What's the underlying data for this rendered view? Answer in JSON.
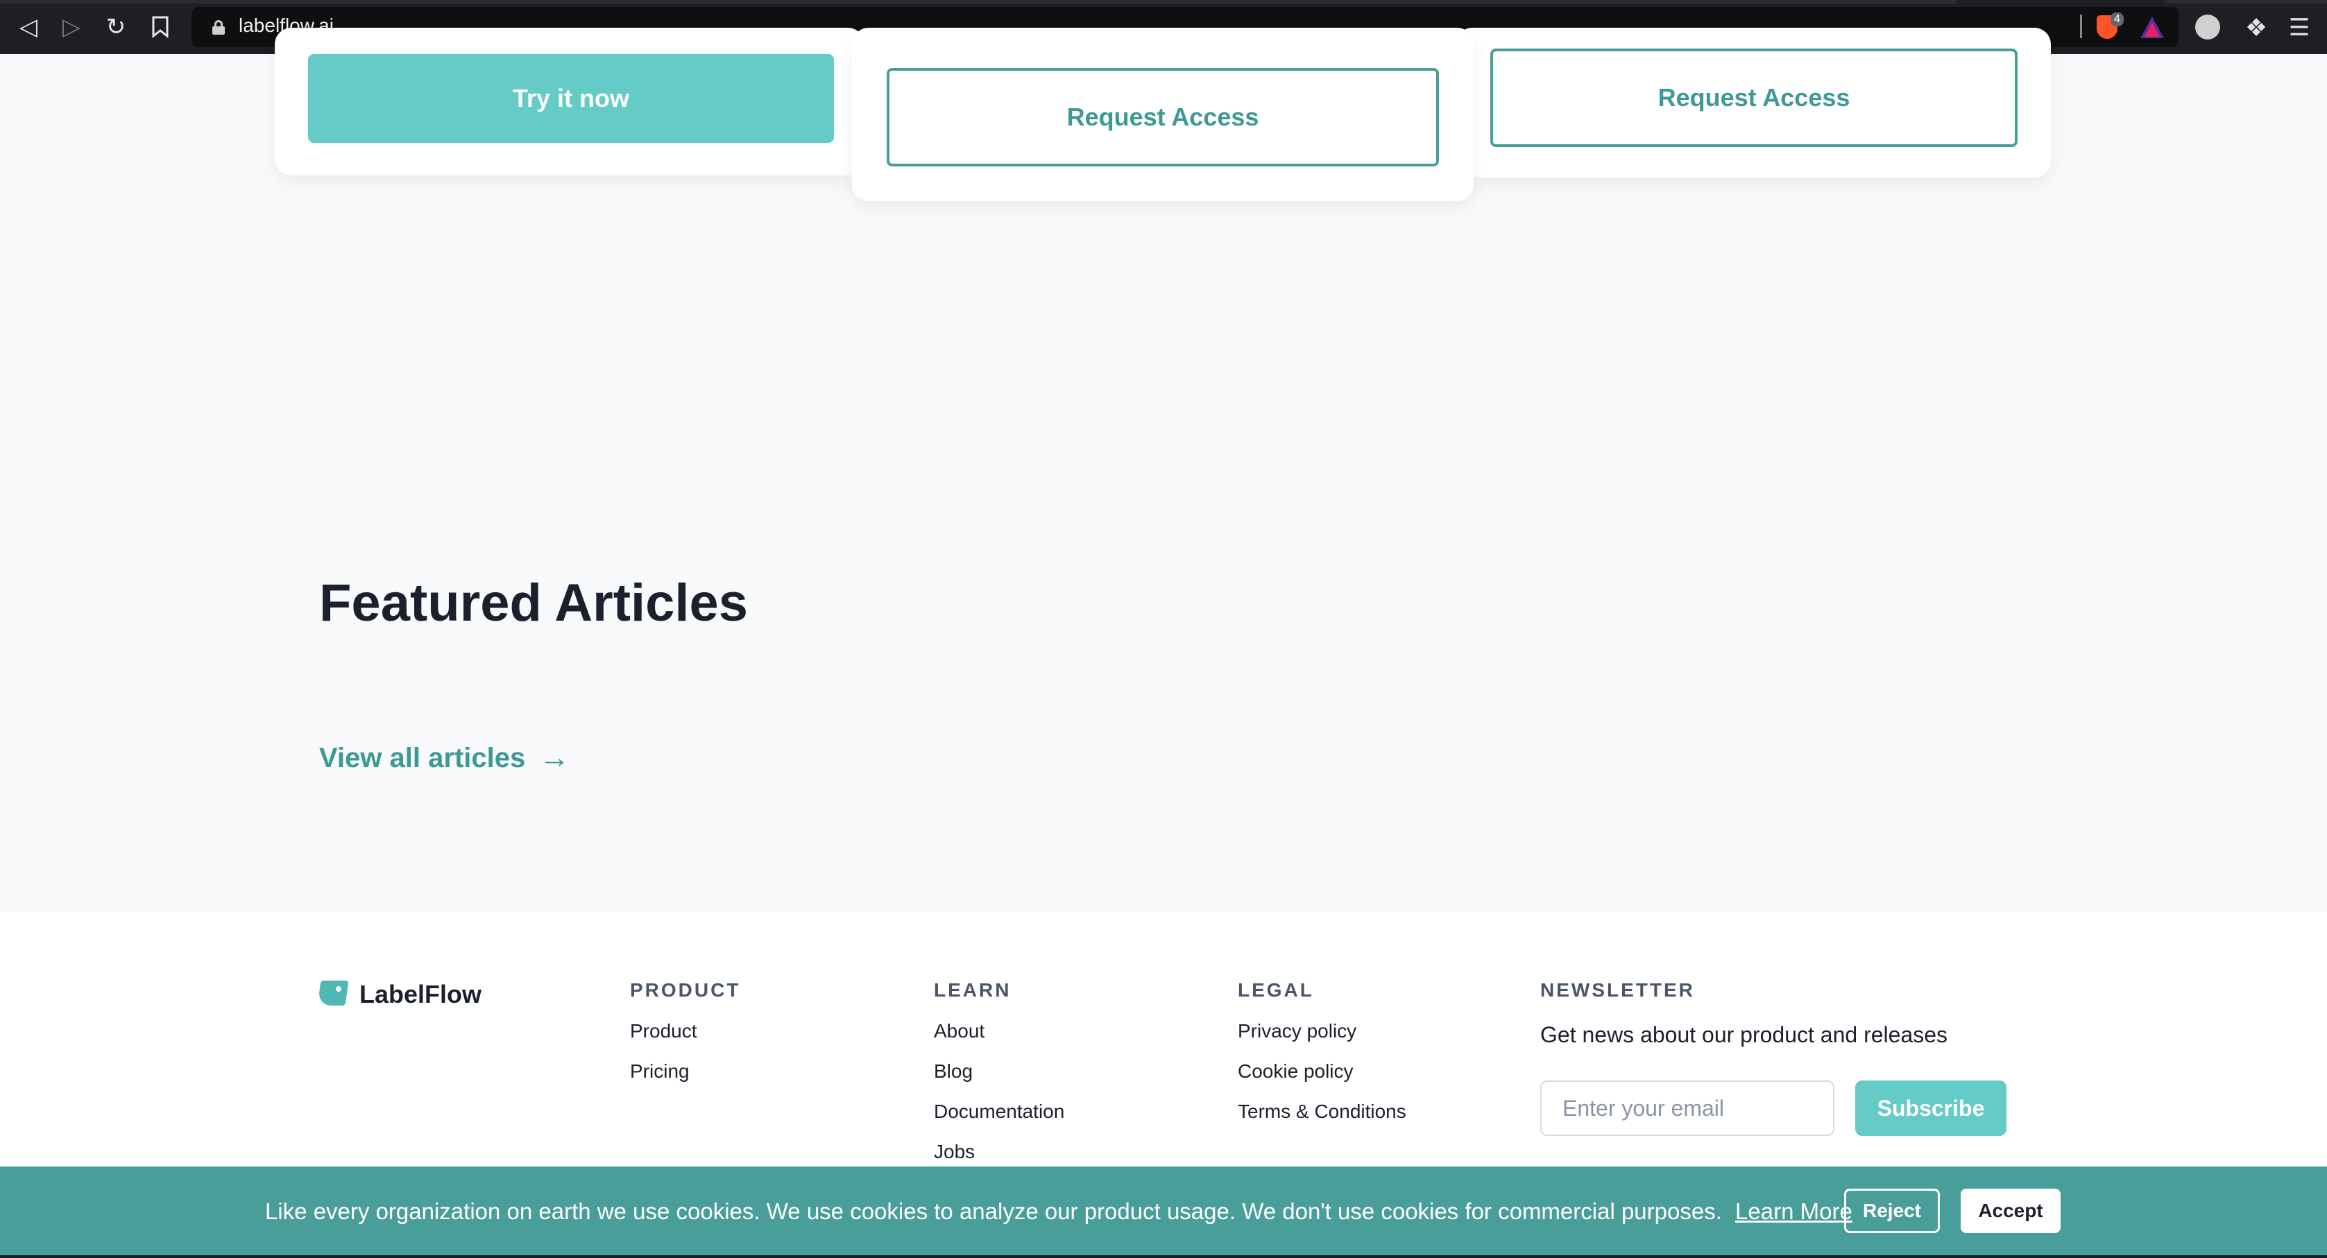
{
  "browser": {
    "url": "labelflow.ai",
    "extension_badge": "4",
    "icons": [
      "back-icon",
      "forward-icon",
      "reload-icon",
      "bookmark-icon",
      "lock-icon",
      "brave-shield-icon",
      "triangle-extension-icon",
      "profile-icon",
      "puzzle-icon",
      "menu-icon"
    ]
  },
  "pricing": {
    "card_1_button": "Try it now",
    "card_2_button": "Request Access",
    "card_3_button": "Request Access"
  },
  "featured": {
    "title": "Featured Articles",
    "view_all": "View all articles",
    "arrow": "→"
  },
  "footer": {
    "brand": "LabelFlow",
    "product": {
      "title": "PRODUCT",
      "links": [
        "Product",
        "Pricing"
      ]
    },
    "learn": {
      "title": "LEARN",
      "links": [
        "About",
        "Blog",
        "Documentation",
        "Jobs"
      ]
    },
    "legal": {
      "title": "LEGAL",
      "links": [
        "Privacy policy",
        "Cookie policy",
        "Terms & Conditions"
      ]
    },
    "newsletter": {
      "title": "NEWSLETTER",
      "description": "Get news about our product and releases",
      "email_placeholder": "Enter your email",
      "subscribe_label": "Subscribe"
    }
  },
  "cookie_banner": {
    "text": "Like every organization on earth we use cookies. We use cookies to analyze our product usage. We don't use cookies for commercial purposes.",
    "learn_more": "Learn More",
    "reject": "Reject",
    "accept": "Accept"
  },
  "colors": {
    "accent": "#65cbc6",
    "accent_dark": "#4a9e9a",
    "page_bg": "#f8f9fb"
  }
}
